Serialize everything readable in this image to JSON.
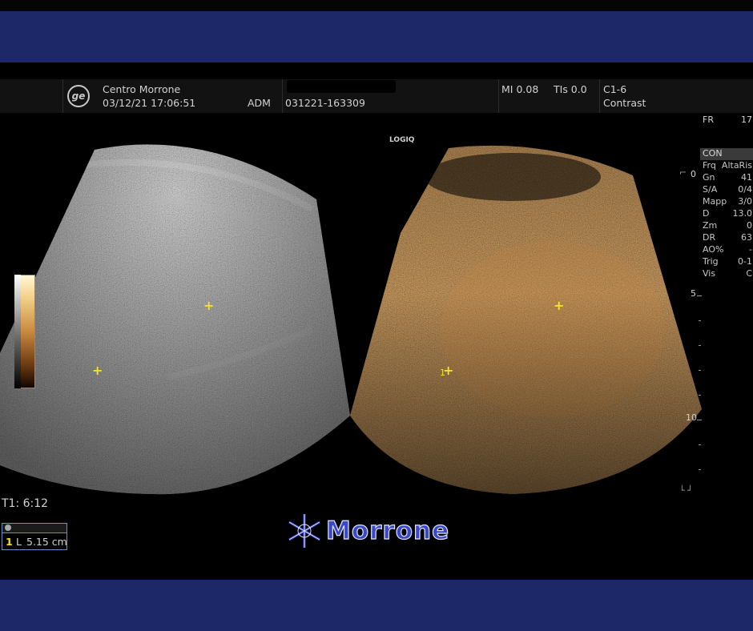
{
  "header": {
    "site_name": "Centro Morrone",
    "datetime": "03/12/21 17:06:51",
    "operator": "ADM",
    "exam_id": "031221-163309",
    "mi": "MI 0.08",
    "tis": "TIs 0.0",
    "probe": "C1-6",
    "mode": "Contrast"
  },
  "logo_text": "LOGIQ",
  "fr": {
    "label": "FR",
    "value": "17"
  },
  "params": {
    "section": "CON",
    "rows": [
      {
        "k": "Frq",
        "v": "AltaRis"
      },
      {
        "k": "Gn",
        "v": "41"
      },
      {
        "k": "S/A",
        "v": "0/4"
      },
      {
        "k": "Mapp",
        "v": "3/0"
      },
      {
        "k": "D",
        "v": "13.0"
      },
      {
        "k": "Zm",
        "v": "0"
      },
      {
        "k": "DR",
        "v": "63"
      },
      {
        "k": "AO%",
        "v": "-"
      },
      {
        "k": "Trig",
        "v": "0-1"
      },
      {
        "k": "Vis",
        "v": "C"
      }
    ]
  },
  "depth_scale": {
    "top": "0",
    "mid": "5",
    "bottom": "10"
  },
  "timer": "T1: 6:12",
  "measurement": {
    "index": "1",
    "label": "L",
    "value": "5.15 cm"
  },
  "marker_labels": {
    "right_cross_label": "1"
  },
  "brand": "Morrone",
  "colors": {
    "band": "#1d2869",
    "cursor": "#f2e12a",
    "brand": "#3848c8"
  }
}
